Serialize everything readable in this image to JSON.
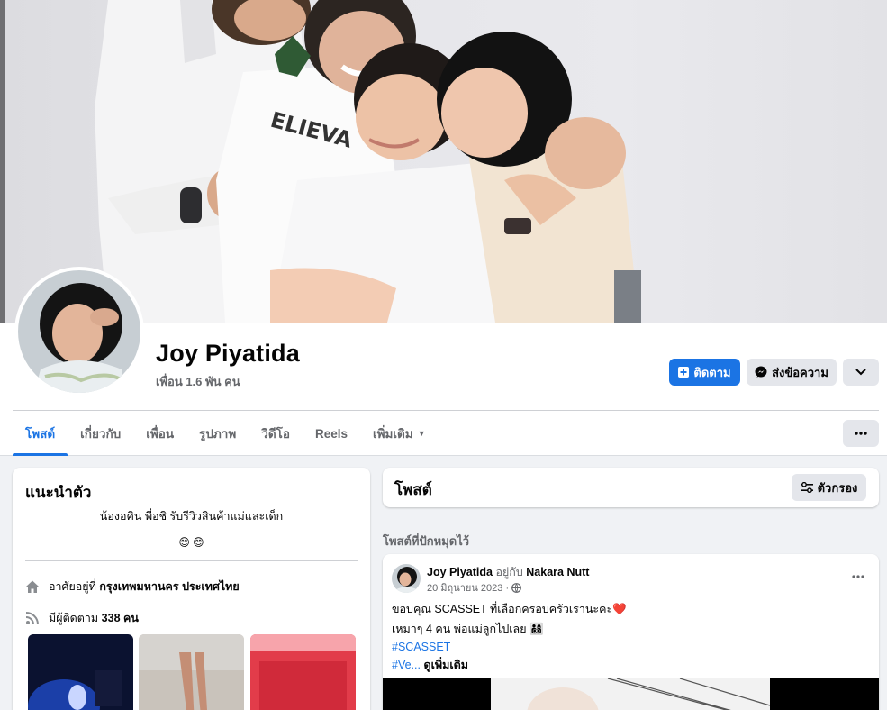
{
  "profile": {
    "name": "Joy Piyatida",
    "friends": "เพื่อน 1.6 พัน คน"
  },
  "actions": {
    "follow": "ติดตาม",
    "message": "ส่งข้อความ"
  },
  "tabs": [
    {
      "label": "โพสต์",
      "active": true
    },
    {
      "label": "เกี่ยวกับ"
    },
    {
      "label": "เพื่อน"
    },
    {
      "label": "รูปภาพ"
    },
    {
      "label": "วิดีโอ"
    },
    {
      "label": "Reels"
    },
    {
      "label": "เพิ่มเติม"
    }
  ],
  "intro": {
    "title": "แนะนำตัว",
    "bio": "น้องอคิน พี่อชิ รับรีวิวสินค้าแม่และเด็ก",
    "emoji": "😊 😊",
    "lives_prefix": "อาศัยอยู่ที่",
    "lives_place": "กรุงเทพมหานคร ประเทศไทย",
    "followers_prefix": "มีผู้ติดตาม",
    "followers_count": "338 คน"
  },
  "posts": {
    "title": "โพสต์",
    "filter_label": "ตัวกรอง",
    "pinned_label": "โพสต์ที่ปักหมุดไว้"
  },
  "post": {
    "author": "Joy Piyatida",
    "with_text": "อยู่กับ",
    "tagged": "Nakara Nutt",
    "date": "20 มิถุนายน 2023 ·",
    "line1": "ขอบคุณ SCASSET ที่เลือกครอบครัวเรานะคะ❤️",
    "line2": "เหมาๆ 4 คน พ่อแม่ลูกไปเลย 👨‍👩‍👦‍👦",
    "hashtag1": "#SCASSET",
    "hashtag2": "#Ve...",
    "see_more": "ดูเพิ่มเติม"
  },
  "colors": {
    "accent": "#1b74e4",
    "secondary_button": "#e4e6eb",
    "page_bg": "#f0f2f5"
  },
  "icons": [
    "plus-person-icon",
    "messenger-icon",
    "chevron-down-icon",
    "more-dots-icon",
    "filter-sliders-icon",
    "home-icon",
    "rss-icon",
    "globe-icon"
  ]
}
